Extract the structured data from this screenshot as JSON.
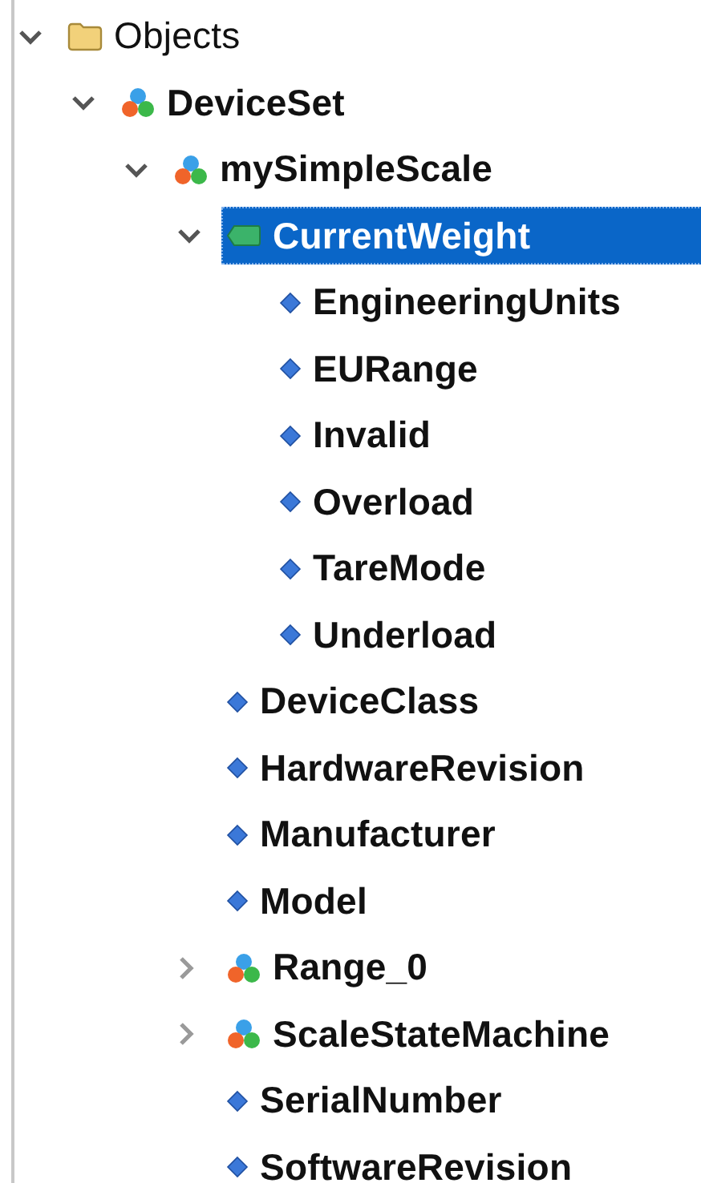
{
  "tree": [
    {
      "label": "Objects",
      "kind": "folder",
      "expanded": true,
      "selected": false,
      "children": [
        {
          "label": "DeviceSet",
          "kind": "object",
          "expanded": true,
          "selected": false,
          "children": [
            {
              "label": "mySimpleScale",
              "kind": "object",
              "expanded": true,
              "selected": false,
              "children": [
                {
                  "label": "CurrentWeight",
                  "kind": "variable",
                  "expanded": true,
                  "selected": true,
                  "children": [
                    {
                      "label": "EngineeringUnits",
                      "kind": "property",
                      "selected": false
                    },
                    {
                      "label": "EURange",
                      "kind": "property",
                      "selected": false
                    },
                    {
                      "label": "Invalid",
                      "kind": "property",
                      "selected": false
                    },
                    {
                      "label": "Overload",
                      "kind": "property",
                      "selected": false
                    },
                    {
                      "label": "TareMode",
                      "kind": "property",
                      "selected": false
                    },
                    {
                      "label": "Underload",
                      "kind": "property",
                      "selected": false
                    }
                  ]
                },
                {
                  "label": "DeviceClass",
                  "kind": "property",
                  "selected": false
                },
                {
                  "label": "HardwareRevision",
                  "kind": "property",
                  "selected": false
                },
                {
                  "label": "Manufacturer",
                  "kind": "property",
                  "selected": false
                },
                {
                  "label": "Model",
                  "kind": "property",
                  "selected": false
                },
                {
                  "label": "Range_0",
                  "kind": "object",
                  "expanded": false,
                  "selected": false
                },
                {
                  "label": "ScaleStateMachine",
                  "kind": "object",
                  "expanded": false,
                  "selected": false
                },
                {
                  "label": "SerialNumber",
                  "kind": "property",
                  "selected": false
                },
                {
                  "label": "SoftwareRevision",
                  "kind": "property",
                  "selected": false
                }
              ]
            }
          ]
        }
      ]
    }
  ]
}
